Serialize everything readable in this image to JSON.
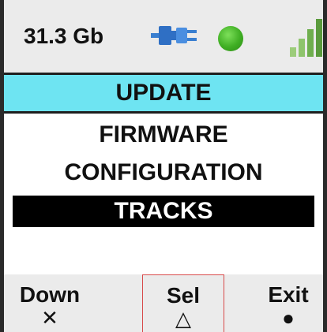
{
  "status": {
    "storage": "31.3 Gb",
    "icons": [
      "plug-icon",
      "status-dot-icon",
      "signal-icon"
    ],
    "status_color": "#3fae23",
    "signal_bars": 4
  },
  "menu": {
    "title": "UPDATE",
    "items": [
      {
        "label": "FIRMWARE",
        "selected": false
      },
      {
        "label": "CONFIGURATION",
        "selected": false
      },
      {
        "label": "TRACKS",
        "selected": true
      }
    ]
  },
  "softkeys": [
    {
      "label": "Down",
      "glyph": "✕"
    },
    {
      "label": "Sel",
      "glyph": "△"
    },
    {
      "label": "Exit",
      "glyph": "●"
    }
  ],
  "colors": {
    "header_bg": "#6ee4f2",
    "selected_bg": "#000000",
    "bar_bg": "#ebebeb",
    "sel_border": "#d84a4a"
  }
}
